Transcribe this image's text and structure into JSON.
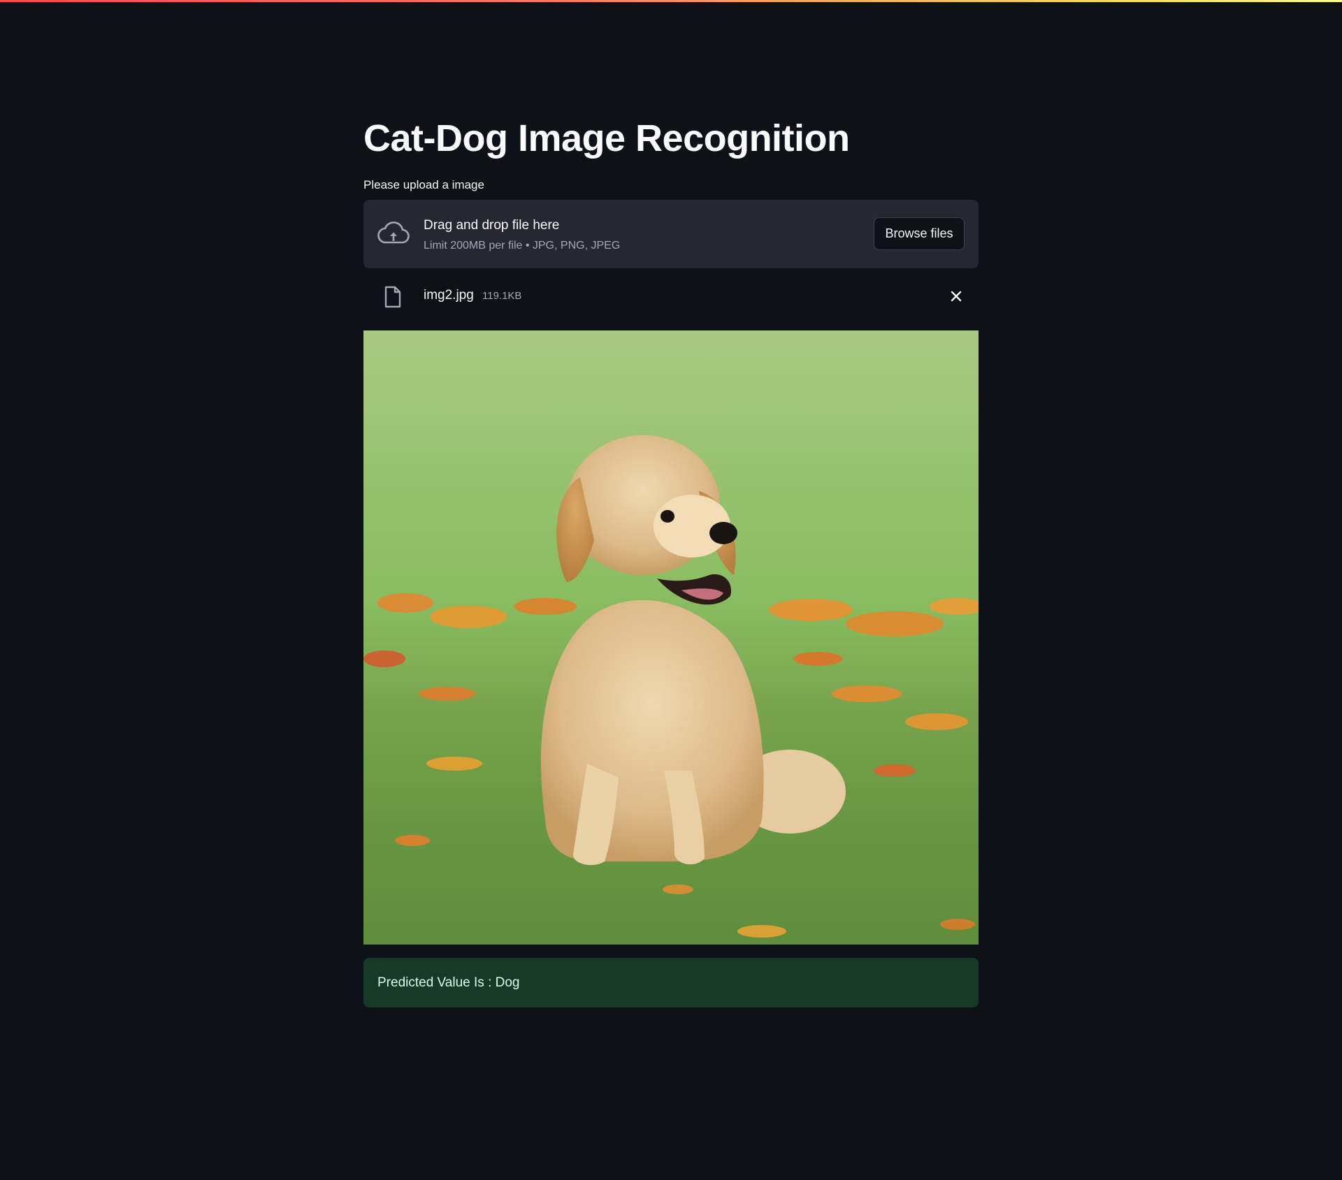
{
  "page": {
    "title": "Cat-Dog Image Recognition",
    "accent_gradient": [
      "#ff4b4b",
      "#ffd35c",
      "#fffd80"
    ],
    "background_color": "#0e1117"
  },
  "uploader": {
    "label": "Please upload a image",
    "drop_text": "Drag and drop file here",
    "limit_text": "Limit 200MB per file • JPG, PNG, JPEG",
    "browse_label": "Browse files",
    "icon": "cloud-upload-icon"
  },
  "uploaded_file": {
    "name": "img2.jpg",
    "size": "119.1KB",
    "icon": "file-icon",
    "remove_icon": "close-icon"
  },
  "image": {
    "subject": "golden retriever puppy sitting in grass with orange flower petals"
  },
  "result": {
    "text": "Predicted Value Is : Dog",
    "color": "#173928"
  }
}
